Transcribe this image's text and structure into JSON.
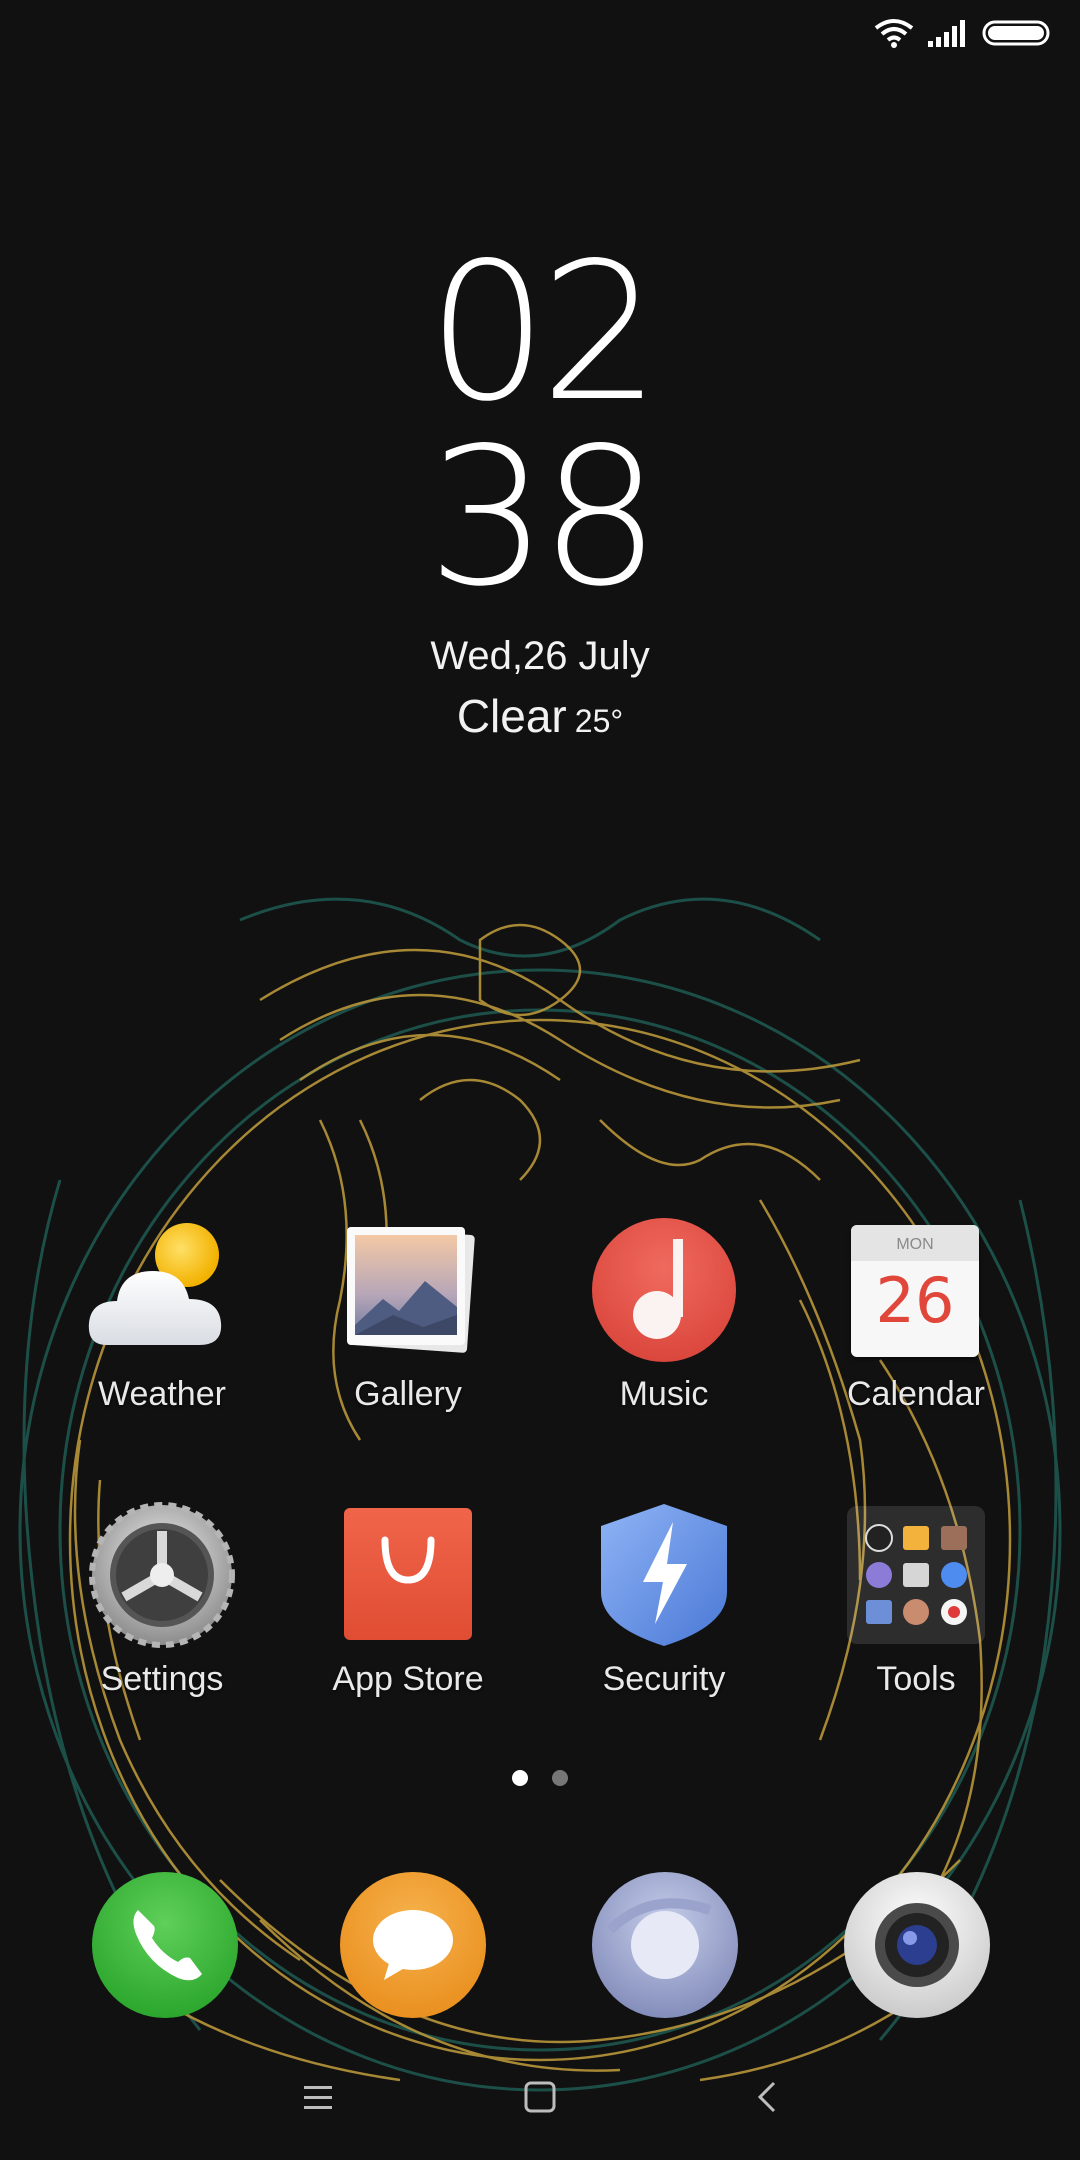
{
  "status_bar": {
    "wifi_icon": "wifi-icon",
    "signal_icon": "signal-icon",
    "battery_icon": "battery-icon"
  },
  "clock": {
    "hour": "02",
    "minute": "38"
  },
  "date": "Wed,26 July",
  "weather": {
    "condition": "Clear",
    "temperature": "25°"
  },
  "apps_row1": [
    {
      "label": "Weather",
      "icon": "weather-icon"
    },
    {
      "label": "Gallery",
      "icon": "gallery-icon"
    },
    {
      "label": "Music",
      "icon": "music-icon"
    },
    {
      "label": "Calendar",
      "icon": "calendar-icon"
    }
  ],
  "apps_row2": [
    {
      "label": "Settings",
      "icon": "settings-icon"
    },
    {
      "label": "App Store",
      "icon": "app-store-icon"
    },
    {
      "label": "Security",
      "icon": "security-icon"
    },
    {
      "label": "Tools",
      "icon": "tools-folder-icon"
    }
  ],
  "calendar_icon": {
    "weekday": "MON",
    "day": "26"
  },
  "page_indicator": {
    "pages": 2,
    "current": 1
  },
  "dock": [
    "phone-icon",
    "messages-icon",
    "browser-icon",
    "camera-icon"
  ],
  "nav": [
    "menu-icon",
    "home-icon",
    "back-icon"
  ],
  "colors": {
    "background": "#111111",
    "wallpaper_line_gold": "#b8953a",
    "wallpaper_line_teal": "#1f5a52"
  }
}
